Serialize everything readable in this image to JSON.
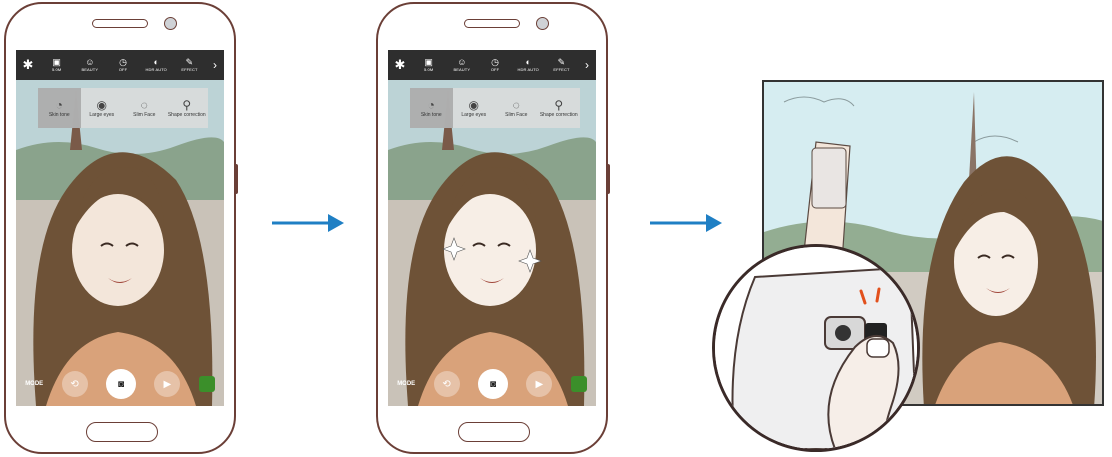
{
  "screens": [
    {
      "toolbar": {
        "settings_icon": "gear-icon",
        "options": [
          {
            "icon": "resolution-icon",
            "label": "5.0M"
          },
          {
            "icon": "beauty-face-icon",
            "label": "BEAUTY"
          },
          {
            "icon": "timer-icon",
            "label": "OFF"
          },
          {
            "icon": "hdr-icon",
            "label": "HDR AUTO"
          },
          {
            "icon": "effect-icon",
            "label": "EFFECT"
          }
        ],
        "more_icon": "chevron-right-icon"
      },
      "beauty_options": [
        "Skin tone",
        "Large eyes",
        "Slim Face",
        "Shape correction"
      ],
      "selected_beauty": "Skin tone",
      "bottom": {
        "mode_label": "MODE"
      }
    },
    {
      "toolbar": {
        "settings_icon": "gear-icon",
        "options": [
          {
            "icon": "resolution-icon",
            "label": "5.0M"
          },
          {
            "icon": "beauty-face-icon",
            "label": "BEAUTY"
          },
          {
            "icon": "timer-icon",
            "label": "OFF"
          },
          {
            "icon": "hdr-icon",
            "label": "HDR AUTO"
          },
          {
            "icon": "effect-icon",
            "label": "EFFECT"
          }
        ],
        "more_icon": "chevron-right-icon"
      },
      "beauty_options": [
        "Skin tone",
        "Large eyes",
        "Slim Face",
        "Shape correction"
      ],
      "selected_beauty": "Skin tone",
      "bottom": {
        "mode_label": "MODE"
      }
    }
  ],
  "colors": {
    "arrow": "#1f7fc4",
    "phone_outline": "#6b3f37",
    "hair": "#6e5237",
    "skin": "#f3e6da",
    "sweater": "#d9a27a"
  }
}
